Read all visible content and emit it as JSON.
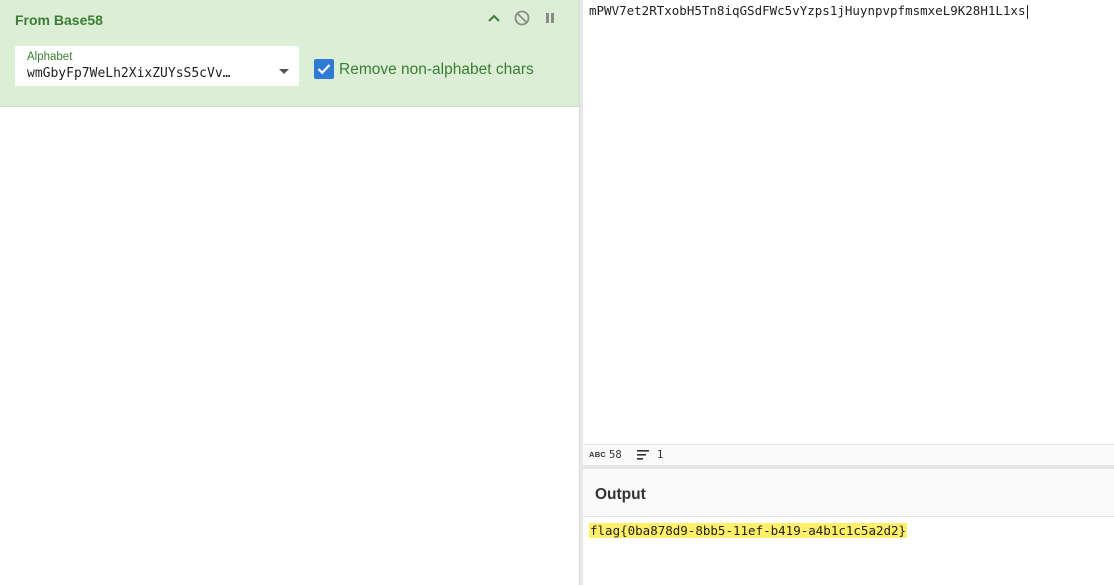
{
  "recipe": {
    "operation": {
      "title": "From Base58",
      "alphabet_label": "Alphabet",
      "alphabet_value": "wmGbyFp7WeLh2XixZUYsS5cVv…",
      "remove_nonalphabet_label": "Remove non-alphabet chars",
      "remove_nonalphabet_checked": true,
      "controls": [
        "chevron-up-icon",
        "disable-icon",
        "pause-icon"
      ]
    }
  },
  "input": {
    "text": "mPWV7et2RTxobH5Tn8iqGSdFWc5vYzps1jHuynpvpfmsmxeL9K28H1L1xs",
    "stats": {
      "abc_label": "ABC",
      "length": "58",
      "lines": "1"
    }
  },
  "output": {
    "title": "Output",
    "text": "flag{0ba878d9-8bb5-11ef-b419-a4b1c1c5a2d2}",
    "highlight_color": "#fff06a"
  },
  "colors": {
    "operation_bg": "#dcefd6",
    "operation_accent": "#3a7d34",
    "checkbox": "#2e7bd6"
  }
}
